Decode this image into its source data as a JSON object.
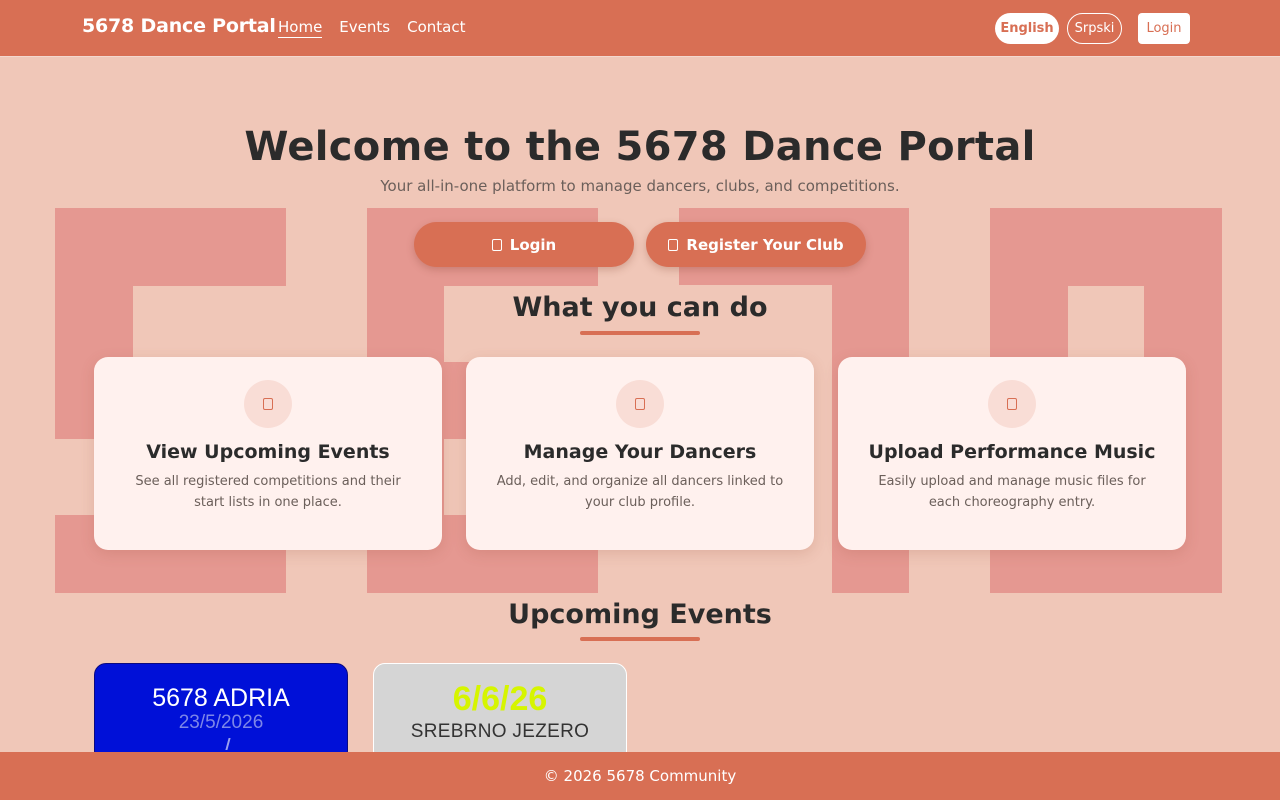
{
  "nav": {
    "brand": "5678 Dance Portal",
    "links": [
      "Home",
      "Events",
      "Contact"
    ],
    "lang_english": "English",
    "lang_serbian": "Srpski",
    "login": "Login"
  },
  "hero": {
    "title": "Welcome to the 5678 Dance Portal",
    "subtitle": "Your all-in-one platform to manage dancers, clubs, and competitions.",
    "login_button": "Login",
    "register_button": "Register Your Club"
  },
  "features": {
    "heading": "What you can do",
    "cards": [
      {
        "title": "View Upcoming Events",
        "desc": "See all registered competitions and their start lists in one place."
      },
      {
        "title": "Manage Your Dancers",
        "desc": "Add, edit, and organize all dancers linked to your club profile."
      },
      {
        "title": "Upload Performance Music",
        "desc": "Easily upload and manage music files for each choreography entry."
      }
    ]
  },
  "events": {
    "heading": "Upcoming Events",
    "items": [
      {
        "name": "5678 ADRIA",
        "date": "23/5/2026"
      },
      {
        "date": "6/6/26",
        "name": "SREBRNO JEZERO"
      }
    ]
  },
  "footer": {
    "copyright": "© 2026 5678 Community"
  },
  "colors": {
    "primary": "#d86f54",
    "background": "#f0c7b8",
    "pattern": "#e59891",
    "card": "#fff1ee"
  }
}
